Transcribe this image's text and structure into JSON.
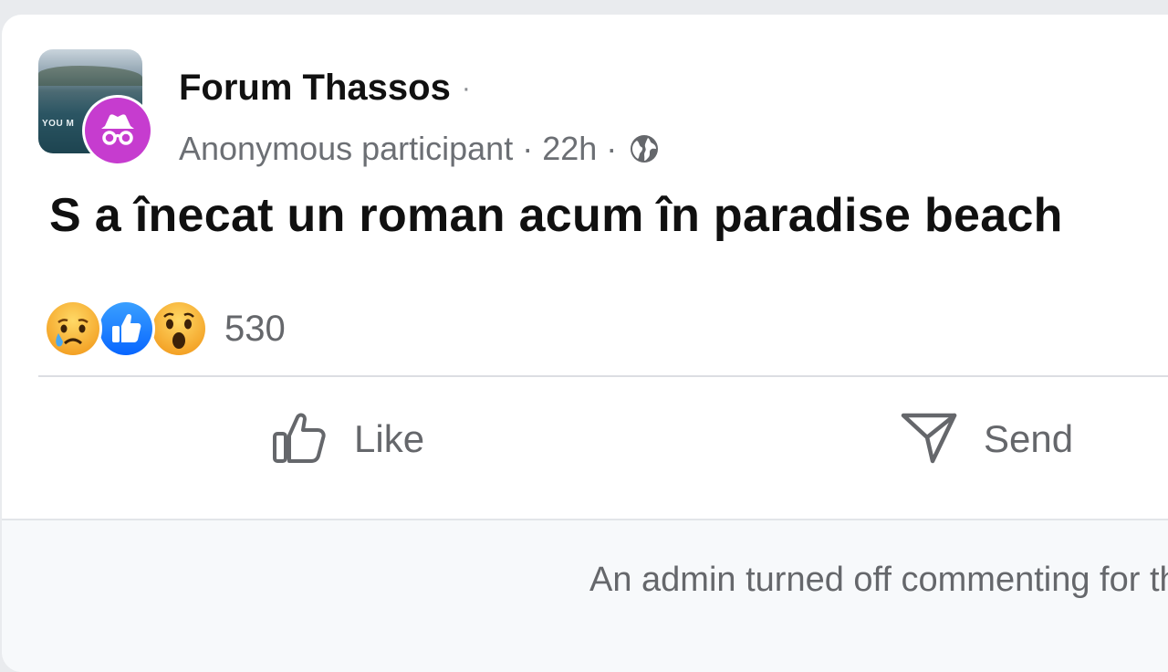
{
  "post": {
    "group_name": "Forum Thassos",
    "title_separator": "·",
    "author": "Anonymous participant",
    "meta_separator_1": "·",
    "time": "22h",
    "meta_separator_2": "·",
    "privacy_icon": "globe-icon",
    "avatar_tag": "YOU M",
    "text": "S a înecat un roman acum în paradise beach"
  },
  "reactions": {
    "icons": [
      "sad-reaction-icon",
      "like-reaction-icon",
      "wow-reaction-icon"
    ],
    "count": "530"
  },
  "actions": {
    "like_label": "Like",
    "send_label": "Send"
  },
  "footer": {
    "comments_notice": "An admin turned off commenting for this post."
  },
  "colors": {
    "anonymous_badge": "#c63ccf",
    "like_blue": "#1877f2",
    "reaction_yellow": "#f7b125",
    "muted_text": "#65676b"
  }
}
